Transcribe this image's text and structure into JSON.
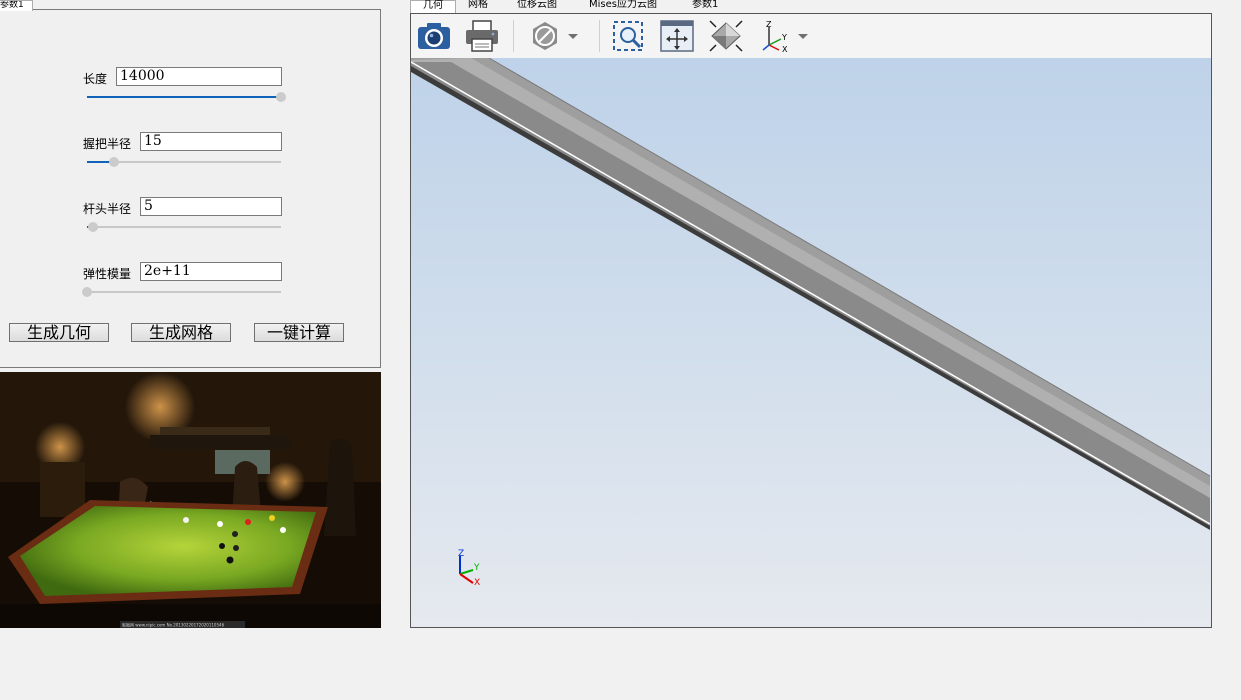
{
  "left_tab": {
    "label": "参数1"
  },
  "params": {
    "length": {
      "label": "长度",
      "value": "14000",
      "slider_fraction": 1.0
    },
    "grip_radius": {
      "label": "握把半径",
      "value": "15",
      "slider_fraction": 0.14
    },
    "tip_radius": {
      "label": "杆头半径",
      "value": "5",
      "slider_fraction": 0.03
    },
    "elastic_modulus": {
      "label": "弹性模量",
      "value": "2e+11",
      "slider_fraction": 0.0
    }
  },
  "buttons": {
    "generate_geometry": "生成几何",
    "generate_mesh": "生成网格",
    "compute": "一键计算"
  },
  "photo": {
    "caption": "昵图网 www.nipic.com  No.20130220172020110546"
  },
  "tabs": [
    {
      "label": "几何",
      "active": true
    },
    {
      "label": "网格",
      "active": false
    },
    {
      "label": "位移云图",
      "active": false
    },
    {
      "label": "Mises应力云图",
      "active": false
    },
    {
      "label": "参数1",
      "active": false
    }
  ],
  "toolbar": {
    "screenshot": "camera-icon",
    "print": "printer-icon",
    "display_mode": "hexagon-slash-icon",
    "zoom_window": "zoom-window-icon",
    "fit_all": "fit-all-icon",
    "view_iso": "iso-view-icon",
    "axes": "axes-icon"
  },
  "triad": {
    "x": "X",
    "y": "Y",
    "z": "Z"
  },
  "colors": {
    "axis_x": "#e00000",
    "axis_y": "#00b000",
    "axis_z": "#0030d0",
    "accent": "#0f63b8"
  }
}
